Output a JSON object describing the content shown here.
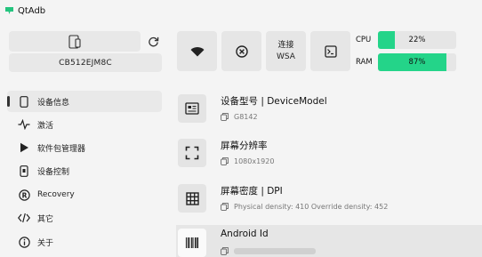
{
  "app": {
    "title": "QtAdb"
  },
  "device": {
    "serial": "CB512EJM8C",
    "icon": "phone-tablet-icon",
    "refresh_icon": "refresh-icon"
  },
  "toolbar": {
    "wifi_icon": "wifi-icon",
    "disconnect_icon": "close-circle-icon",
    "wsa_line1": "连接",
    "wsa_line2": "WSA",
    "terminal_icon": "terminal-icon"
  },
  "stats": {
    "cpu": {
      "label": "CPU",
      "value": 0.22,
      "text": "22%"
    },
    "ram": {
      "label": "RAM",
      "value": 0.87,
      "text": "87%"
    },
    "bar_color": "#24d489"
  },
  "sidebar": {
    "items": [
      {
        "label": "设备信息",
        "icon": "phone-icon",
        "active": true
      },
      {
        "label": "激活",
        "icon": "pulse-icon",
        "active": false
      },
      {
        "label": "软件包管理器",
        "icon": "play-icon",
        "active": false
      },
      {
        "label": "设备控制",
        "icon": "device-control-icon",
        "active": false
      },
      {
        "label": "Recovery",
        "icon": "recovery-icon",
        "active": false
      },
      {
        "label": "其它",
        "icon": "code-icon",
        "active": false
      },
      {
        "label": "关于",
        "icon": "info-icon",
        "active": false
      }
    ]
  },
  "info": {
    "items": [
      {
        "title": "设备型号 | DeviceModel",
        "value": "G8142",
        "icon": "model-icon"
      },
      {
        "title": "屏幕分辨率",
        "value": "1080x1920",
        "icon": "fullscreen-icon"
      },
      {
        "title": "屏幕密度 | DPI",
        "value": "Physical density: 410 Override density: 452",
        "icon": "grid-icon"
      },
      {
        "title": "Android Id",
        "value": "",
        "icon": "barcode-icon"
      }
    ]
  }
}
